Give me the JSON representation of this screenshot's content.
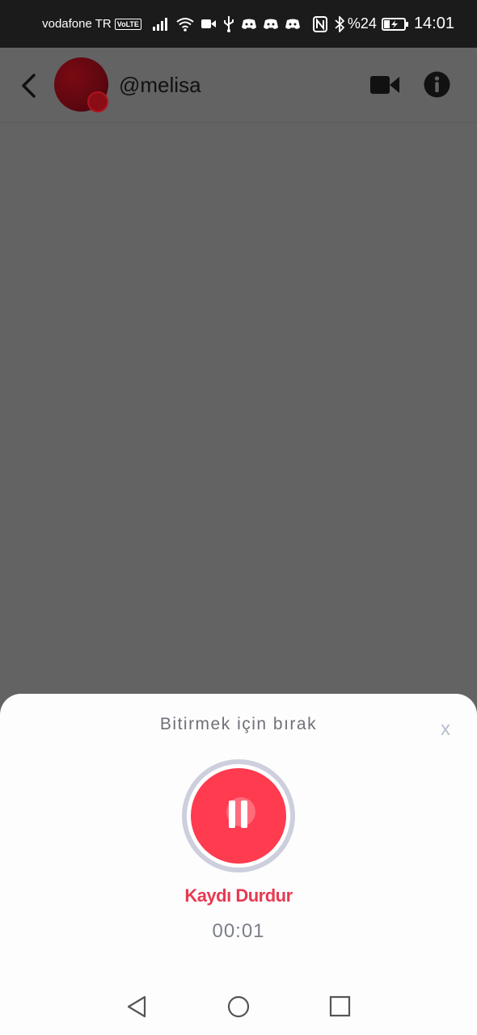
{
  "status_bar": {
    "carrier": "vodafone TR",
    "volte_badge": "VoLTE",
    "battery_percent": "%24",
    "time": "14:01",
    "icons": [
      "signal-icon",
      "wifi-icon",
      "video-camera-icon",
      "usb-icon",
      "discord-icon",
      "discord-icon",
      "discord-icon",
      "nfc-icon",
      "bluetooth-icon",
      "battery-charging-icon"
    ]
  },
  "header": {
    "username": "@melisa",
    "icons": [
      "back-arrow-icon",
      "avatar",
      "video-call-icon",
      "info-icon"
    ]
  },
  "sheet": {
    "hint": "Bitirmek için bırak",
    "close_label": "x",
    "stop_label": "Kaydı Durdur",
    "timer": "00:01",
    "accent_color": "#ff3b4f",
    "label_color": "#e83a51"
  },
  "nav_bar": {
    "icons": [
      "nav-back-icon",
      "nav-home-icon",
      "nav-recents-icon"
    ]
  }
}
